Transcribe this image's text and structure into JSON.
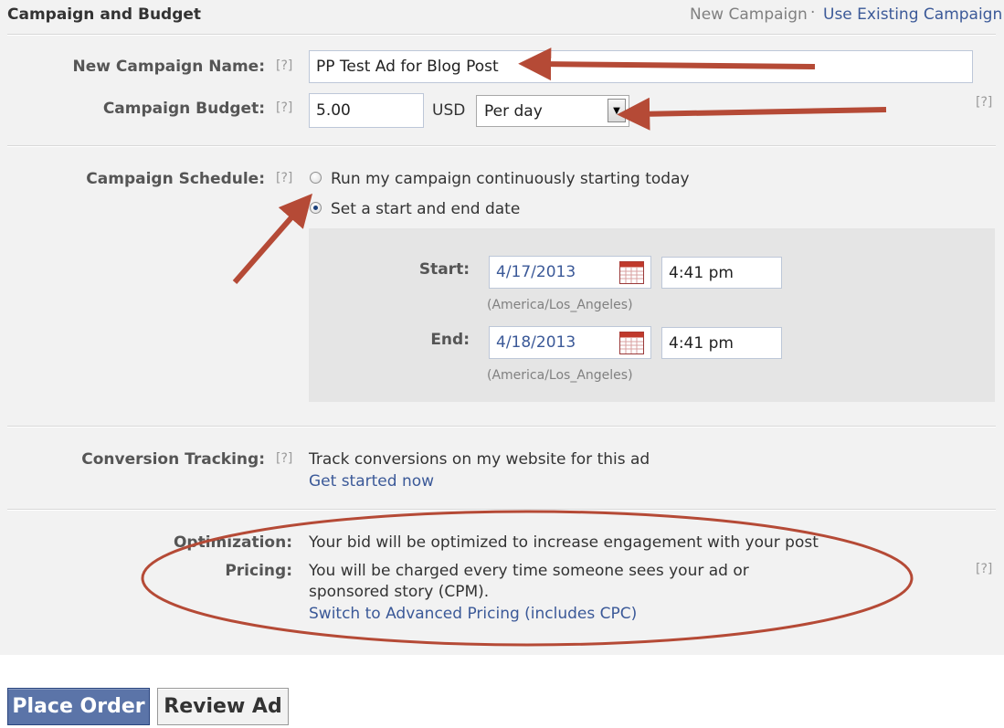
{
  "header": {
    "title": "Campaign and Budget",
    "new_campaign": "New Campaign",
    "separator": "·",
    "use_existing": "Use Existing Campaign"
  },
  "help_marker": "[?]",
  "campaign_name": {
    "label": "New Campaign Name:",
    "value": "PP Test Ad for Blog Post"
  },
  "budget": {
    "label": "Campaign Budget:",
    "value": "5.00",
    "currency": "USD",
    "period": "Per day"
  },
  "schedule": {
    "label": "Campaign Schedule:",
    "option_continuous": "Run my campaign continuously starting today",
    "option_dates": "Set a start and end date",
    "selected": "option_dates",
    "start": {
      "label": "Start:",
      "date": "4/17/2013",
      "time": "4:41 pm",
      "timezone": "(America/Los_Angeles)"
    },
    "end": {
      "label": "End:",
      "date": "4/18/2013",
      "time": "4:41 pm",
      "timezone": "(America/Los_Angeles)"
    }
  },
  "conversion": {
    "label": "Conversion Tracking:",
    "text": "Track conversions on my website for this ad",
    "link": "Get started now"
  },
  "optimization": {
    "label": "Optimization:",
    "text": "Your bid will be optimized to increase engagement with your post"
  },
  "pricing": {
    "label": "Pricing:",
    "line1": "You will be charged every time someone sees your ad or",
    "line2": "sponsored story (CPM).",
    "link": "Switch to Advanced Pricing (includes CPC)"
  },
  "buttons": {
    "place_order": "Place Order",
    "review_ad": "Review Ad"
  },
  "colors": {
    "link": "#3b5998",
    "primary_button": "#5b74a8",
    "annotation": "#b54a36",
    "panel_bg": "#f2f2f2"
  }
}
